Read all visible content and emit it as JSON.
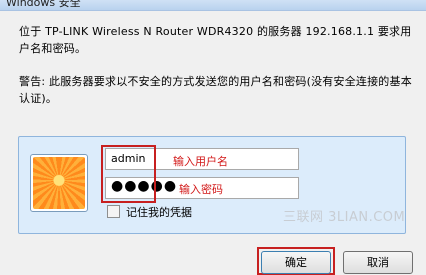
{
  "window": {
    "title": "Windows 安全"
  },
  "message": {
    "description": "位于 TP-LINK Wireless N Router WDR4320 的服务器 192.168.1.1 要求用户名和密码。",
    "warning": "警告: 此服务器要求以不安全的方式发送您的用户名和密码(没有安全连接的基本认证)。"
  },
  "credentials": {
    "username_value": "admin",
    "password_value": "●●●●●",
    "username_hint": "输入用户名",
    "password_hint": "输入密码",
    "remember_label": "记住我的凭据",
    "remember_checked": false
  },
  "buttons": {
    "ok": "确定",
    "cancel": "取消"
  },
  "watermark": "三联网 3LIAN.COM",
  "colors": {
    "annotation_red": "#c72020",
    "panel_blue": "#dcecfb"
  }
}
